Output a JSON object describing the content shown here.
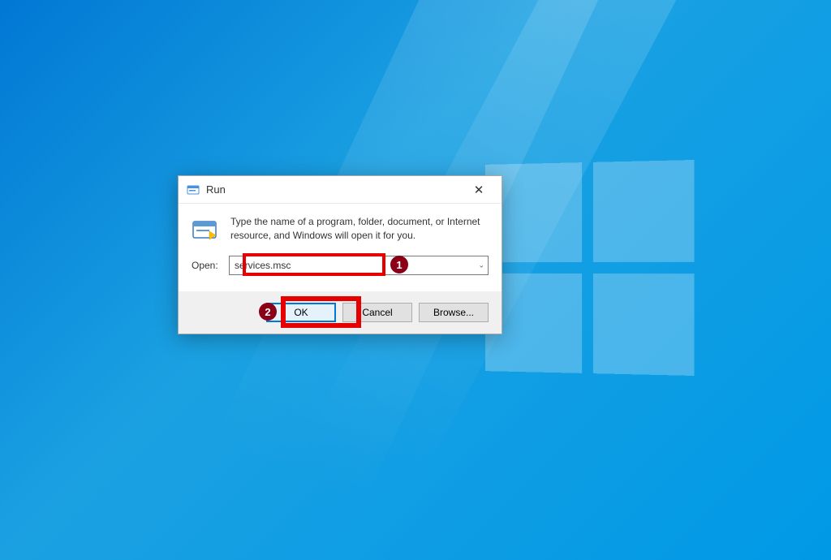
{
  "dialog": {
    "title": "Run",
    "description": "Type the name of a program, folder, document, or Internet resource, and Windows will open it for you.",
    "open_label": "Open:",
    "input_value": "services.msc",
    "buttons": {
      "ok": "OK",
      "cancel": "Cancel",
      "browse": "Browse..."
    }
  },
  "annotations": {
    "badge1": "1",
    "badge2": "2"
  }
}
